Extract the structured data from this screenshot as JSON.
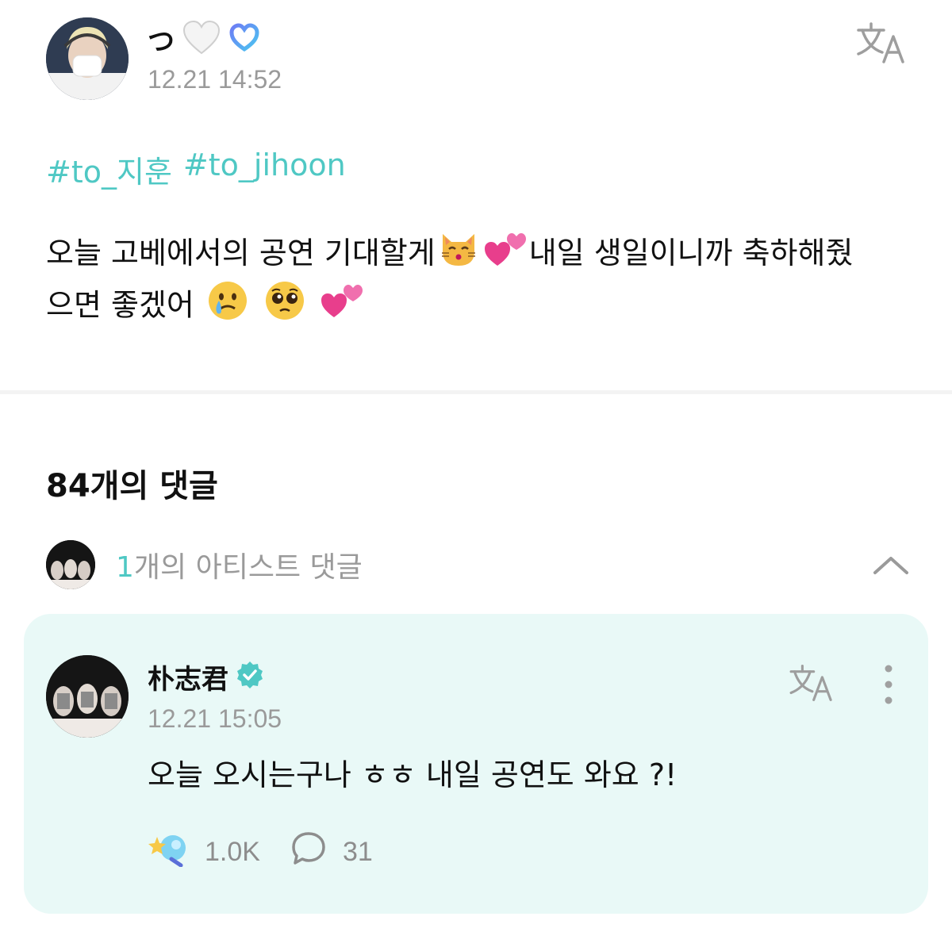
{
  "post": {
    "author_name": "つ",
    "timestamp": "12.21 14:52",
    "hashtags": [
      "#to_지훈",
      "#to_jihoon"
    ],
    "body_part1": "오늘 고베에서의 공연 기대할게",
    "body_part2": "내일 생일이니까 축하해줬",
    "body_part3": "으면 좋겠어",
    "icons": {
      "author_heart": "white-heart-icon",
      "membership_badge": "membership-badge-icon",
      "translate": "translate-icon"
    }
  },
  "comments": {
    "count_title": "84개의 댓글",
    "artist_comments": {
      "count": "1",
      "label": "개의 아티스트 댓글"
    },
    "items": [
      {
        "author_name": "朴志君",
        "timestamp": "12.21 15:05",
        "text": "오늘 오시는구나 ㅎㅎ 내일 공연도 와요 ?!",
        "likes": "1.0K",
        "replies": "31"
      }
    ]
  },
  "colors": {
    "accent": "#4fc8c4",
    "muted": "#9a9a9a",
    "card_bg": "#e9f9f7"
  }
}
